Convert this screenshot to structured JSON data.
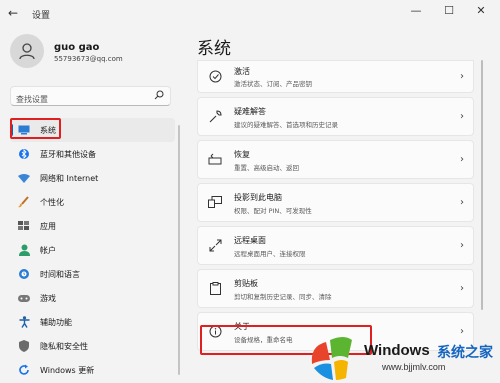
{
  "window": {
    "title": "设置",
    "back_icon": "←",
    "controls": {
      "minimize": "—",
      "maximize": "☐",
      "close": "✕"
    }
  },
  "user": {
    "name": "guo gao",
    "email": "55793673@qq.com"
  },
  "search": {
    "placeholder": "查找设置"
  },
  "nav": {
    "items": [
      {
        "label": "系统",
        "icon": "monitor-icon",
        "active": true
      },
      {
        "label": "蓝牙和其他设备",
        "icon": "bluetooth-icon"
      },
      {
        "label": "网络和 Internet",
        "icon": "wifi-icon"
      },
      {
        "label": "个性化",
        "icon": "brush-icon"
      },
      {
        "label": "应用",
        "icon": "apps-icon"
      },
      {
        "label": "帐户",
        "icon": "person-icon"
      },
      {
        "label": "时间和语言",
        "icon": "globe-clock-icon"
      },
      {
        "label": "游戏",
        "icon": "gamepad-icon"
      },
      {
        "label": "辅助功能",
        "icon": "accessibility-icon"
      },
      {
        "label": "隐私和安全性",
        "icon": "shield-icon"
      },
      {
        "label": "Windows 更新",
        "icon": "update-icon"
      }
    ]
  },
  "main": {
    "title": "系统",
    "cards": [
      {
        "title": "激活",
        "subtitle": "激活状态、订阅、产品密钥",
        "icon": "check-circle-icon"
      },
      {
        "title": "疑难解答",
        "subtitle": "建议的疑难解答、首选项和历史记录",
        "icon": "wrench-icon"
      },
      {
        "title": "恢复",
        "subtitle": "重置、高级启动、返回",
        "icon": "recovery-icon"
      },
      {
        "title": "投影到此电脑",
        "subtitle": "权限、配对 PIN、可发现性",
        "icon": "projection-icon"
      },
      {
        "title": "远程桌面",
        "subtitle": "远程桌面用户、连接权限",
        "icon": "remote-desktop-icon"
      },
      {
        "title": "剪贴板",
        "subtitle": "剪切和复制历史记录、同步、清除",
        "icon": "clipboard-icon"
      },
      {
        "title": "关于",
        "subtitle": "设备规格，重命名电",
        "icon": "info-icon"
      }
    ],
    "chevron": "›"
  },
  "watermark": {
    "word": "Windows",
    "cn": "系统之家",
    "url": "www.bjjmlv.com"
  },
  "colors": {
    "accent": "#0067c0",
    "highlight": "#e02020",
    "background": "#f3f3f3",
    "card": "#fbfbfb"
  }
}
